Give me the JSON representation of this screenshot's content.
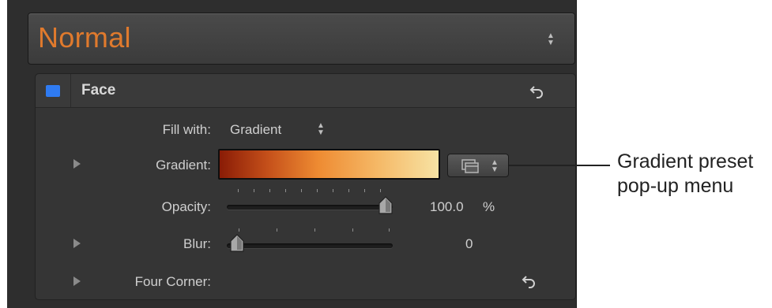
{
  "preset": {
    "title": "Normal"
  },
  "face": {
    "label": "Face",
    "enabled": true,
    "accent": "#2f7bf2"
  },
  "fill_with": {
    "label": "Fill with:",
    "value": "Gradient"
  },
  "gradient": {
    "label": "Gradient:",
    "colors": [
      "#8a1c06",
      "#c5501a",
      "#ee8b32",
      "#f5b866",
      "#f7e3a4"
    ]
  },
  "opacity": {
    "label": "Opacity:",
    "value": "100.0",
    "unit": "%",
    "level": 1.0
  },
  "blur": {
    "label": "Blur:",
    "value": "0",
    "level": 0.0
  },
  "four_corner": {
    "label": "Four Corner:"
  },
  "callout": {
    "line1": "Gradient preset",
    "line2": "pop-up menu"
  },
  "colors": {
    "accent_orange": "#e07a2d",
    "panel_bg": "#2e2e2e"
  },
  "icons": [
    "up-down-arrows-icon",
    "reset-icon",
    "disclosure-triangle-icon",
    "preset-menu-icon",
    "slider-thumb-icon"
  ]
}
